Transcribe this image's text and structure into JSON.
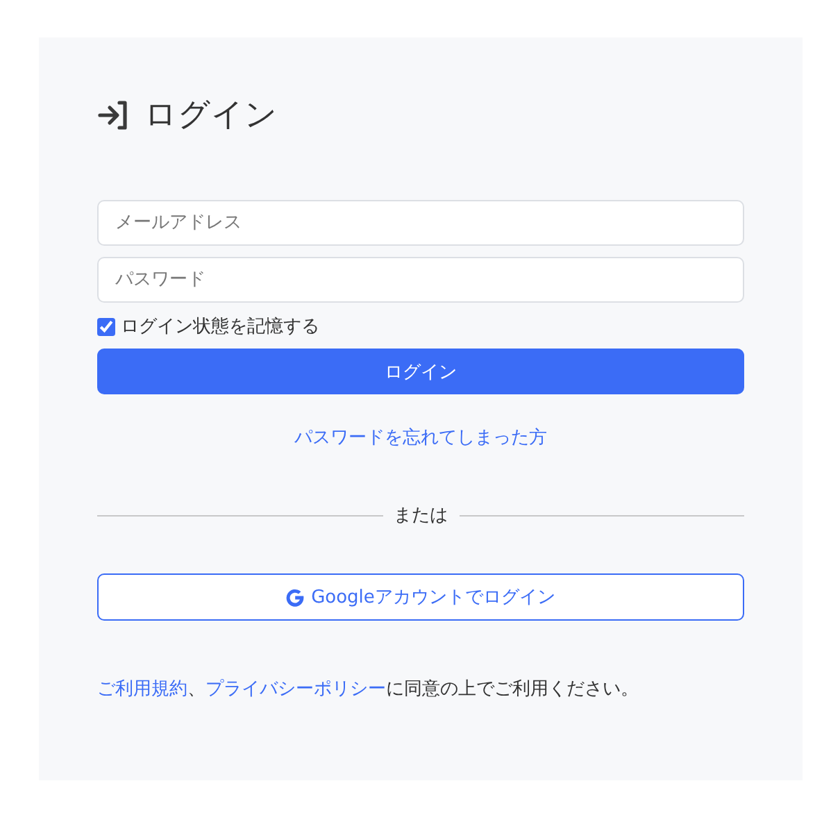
{
  "title": "ログイン",
  "fields": [
    {
      "placeholder": "メールアドレス"
    },
    {
      "placeholder": "パスワード"
    }
  ],
  "remember": {
    "label": "ログイン状態を記憶する",
    "checked": true
  },
  "login_button": "ログイン",
  "forgot_link": "パスワードを忘れてしまった方",
  "divider_text": "または",
  "google_button": "Googleアカウントでログイン",
  "consent": {
    "terms_link": "ご利用規約",
    "separator": "、",
    "privacy_link": "プライバシーポリシー",
    "text": "に同意の上でご利用ください。"
  }
}
